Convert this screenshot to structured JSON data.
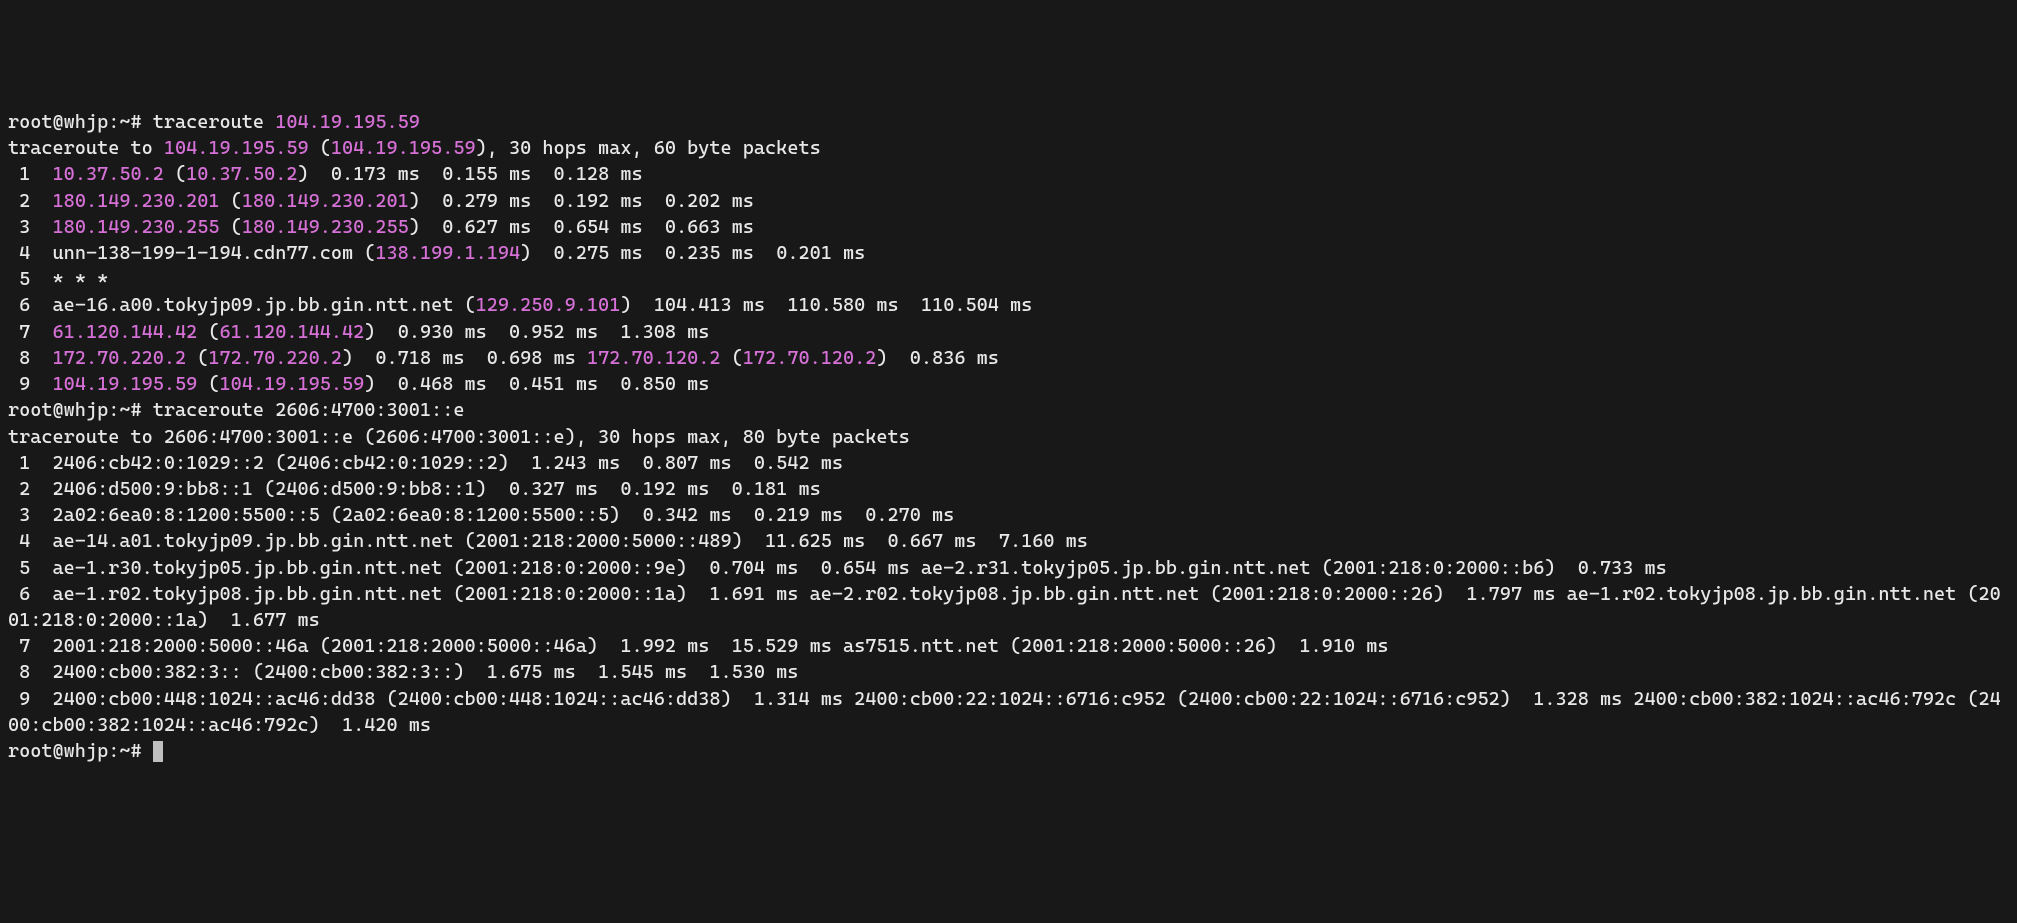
{
  "prompt": "root@whjp:~#",
  "cmd1": {
    "bin": "traceroute",
    "target": "104.19.195.59"
  },
  "hdr1": {
    "pre": "traceroute to ",
    "ip": "104.19.195.59",
    "mid": " (",
    "ip2": "104.19.195.59",
    "post": "), 30 hops max, 60 byte packets"
  },
  "v4": [
    {
      "n": " 1  ",
      "host": "10.37.50.2",
      "p1": " (",
      "ip": "10.37.50.2",
      "p2": ")  ",
      "tail": "0.173 ms  0.155 ms  0.128 ms"
    },
    {
      "n": " 2  ",
      "host": "180.149.230.201",
      "p1": " (",
      "ip": "180.149.230.201",
      "p2": ")  ",
      "tail": "0.279 ms  0.192 ms  0.202 ms"
    },
    {
      "n": " 3  ",
      "host": "180.149.230.255",
      "p1": " (",
      "ip": "180.149.230.255",
      "p2": ")  ",
      "tail": "0.627 ms  0.654 ms  0.663 ms"
    },
    {
      "n": " 4  ",
      "hostPlain": "unn-138-199-1-194.cdn77.com",
      "p1": " (",
      "ip": "138.199.1.194",
      "p2": ")  ",
      "tail": "0.275 ms  0.235 ms  0.201 ms"
    },
    {
      "n": " 5  ",
      "raw": "* * *"
    },
    {
      "n": " 6  ",
      "hostPlain": "ae-16.a00.tokyjp09.jp.bb.gin.ntt.net",
      "p1": " (",
      "ip": "129.250.9.101",
      "p2": ")  ",
      "tail": "104.413 ms  110.580 ms  110.504 ms"
    },
    {
      "n": " 7  ",
      "host": "61.120.144.42",
      "p1": " (",
      "ip": "61.120.144.42",
      "p2": ")  ",
      "tail": "0.930 ms  0.952 ms  1.308 ms"
    },
    {
      "n": " 8  ",
      "host": "172.70.220.2",
      "p1": " (",
      "ip": "172.70.220.2",
      "p2": ")  ",
      "mid1": "0.718 ms  0.698 ms ",
      "host2": "172.70.120.2",
      "p3": " (",
      "ip2": "172.70.120.2",
      "p4": ")  ",
      "tail": "0.836 ms"
    },
    {
      "n": " 9  ",
      "host": "104.19.195.59",
      "p1": " (",
      "ip": "104.19.195.59",
      "p2": ")  ",
      "tail": "0.468 ms  0.451 ms  0.850 ms"
    }
  ],
  "cmd2": {
    "bin": "traceroute",
    "target": "2606:4700:3001::e"
  },
  "hdr2": "traceroute to 2606:4700:3001::e (2606:4700:3001::e), 30 hops max, 80 byte packets",
  "v6": [
    " 1  2406:cb42:0:1029::2 (2406:cb42:0:1029::2)  1.243 ms  0.807 ms  0.542 ms",
    " 2  2406:d500:9:bb8::1 (2406:d500:9:bb8::1)  0.327 ms  0.192 ms  0.181 ms",
    " 3  2a02:6ea0:8:1200:5500::5 (2a02:6ea0:8:1200:5500::5)  0.342 ms  0.219 ms  0.270 ms",
    " 4  ae-14.a01.tokyjp09.jp.bb.gin.ntt.net (2001:218:2000:5000::489)  11.625 ms  0.667 ms  7.160 ms",
    " 5  ae-1.r30.tokyjp05.jp.bb.gin.ntt.net (2001:218:0:2000::9e)  0.704 ms  0.654 ms ae-2.r31.tokyjp05.jp.bb.gin.ntt.net (2001:218:0:2000::b6)  0.733 ms",
    " 6  ae-1.r02.tokyjp08.jp.bb.gin.ntt.net (2001:218:0:2000::1a)  1.691 ms ae-2.r02.tokyjp08.jp.bb.gin.ntt.net (2001:218:0:2000::26)  1.797 ms ae-1.r02.tokyjp08.jp.bb.gin.ntt.net (2001:218:0:2000::1a)  1.677 ms",
    " 7  2001:218:2000:5000::46a (2001:218:2000:5000::46a)  1.992 ms  15.529 ms as7515.ntt.net (2001:218:2000:5000::26)  1.910 ms",
    " 8  2400:cb00:382:3:: (2400:cb00:382:3::)  1.675 ms  1.545 ms  1.530 ms",
    " 9  2400:cb00:448:1024::ac46:dd38 (2400:cb00:448:1024::ac46:dd38)  1.314 ms 2400:cb00:22:1024::6716:c952 (2400:cb00:22:1024::6716:c952)  1.328 ms 2400:cb00:382:1024::ac46:792c (2400:cb00:382:1024::ac46:792c)  1.420 ms"
  ]
}
